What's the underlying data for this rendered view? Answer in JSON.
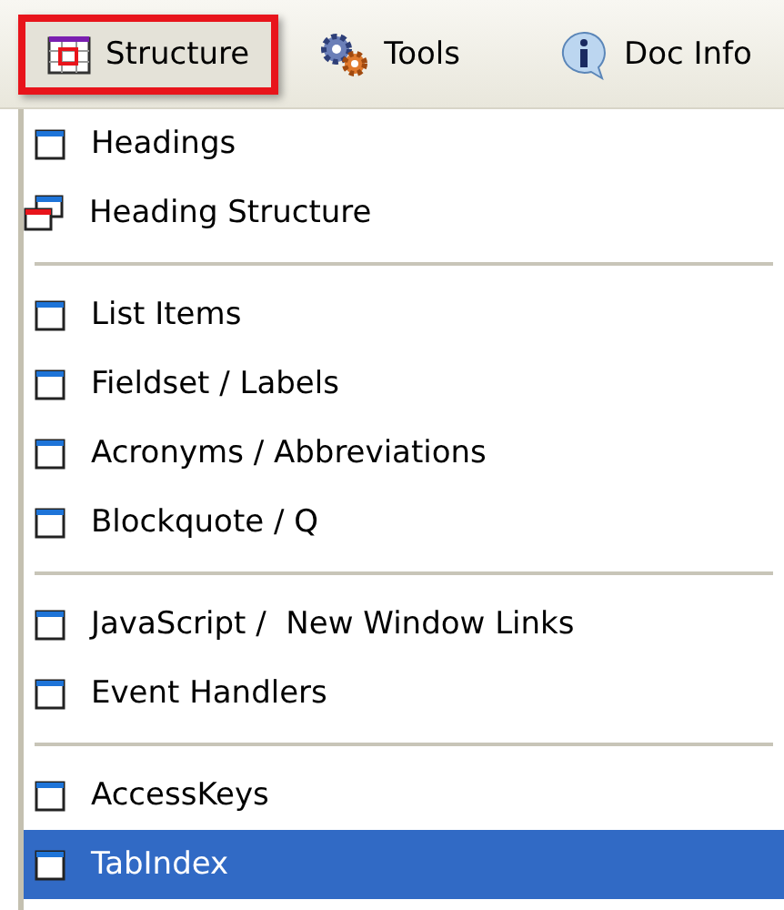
{
  "toolbar": {
    "buttons": [
      {
        "label": "Structure",
        "kind": "grid",
        "selected": true
      },
      {
        "label": "Tools",
        "kind": "gears",
        "selected": false
      },
      {
        "label": "Doc Info",
        "kind": "info",
        "selected": false
      }
    ]
  },
  "menu": {
    "groups": [
      {
        "items": [
          {
            "label": "Headings",
            "kind": "window",
            "selected": false
          },
          {
            "label": "Heading Structure",
            "kind": "windows",
            "selected": false
          }
        ]
      },
      {
        "items": [
          {
            "label": "List Items",
            "kind": "window",
            "selected": false
          },
          {
            "label": "Fieldset / Labels",
            "kind": "window",
            "selected": false
          },
          {
            "label": "Acronyms / Abbreviations",
            "kind": "window",
            "selected": false
          },
          {
            "label": "Blockquote / Q",
            "kind": "window",
            "selected": false
          }
        ]
      },
      {
        "items": [
          {
            "label": "JavaScript /  New Window Links",
            "kind": "window",
            "selected": false
          },
          {
            "label": "Event Handlers",
            "kind": "window",
            "selected": false
          }
        ]
      },
      {
        "items": [
          {
            "label": "AccessKeys",
            "kind": "window",
            "selected": false
          },
          {
            "label": "TabIndex",
            "kind": "window",
            "selected": true
          }
        ]
      }
    ]
  }
}
